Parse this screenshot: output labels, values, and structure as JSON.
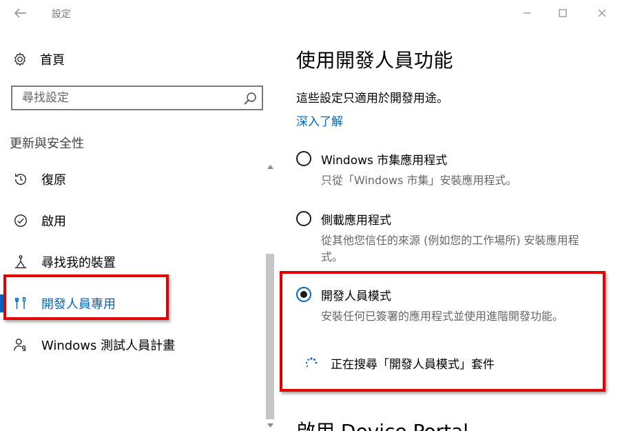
{
  "window": {
    "title": "設定",
    "back_icon": "arrow-left-icon",
    "controls": [
      "minimize-icon",
      "maximize-icon",
      "close-icon"
    ]
  },
  "sidebar": {
    "home_label": "首頁",
    "search_placeholder": "尋找設定",
    "section_title": "更新與安全性",
    "items": [
      {
        "label": "復原",
        "icon": "history-icon",
        "active": false
      },
      {
        "label": "啟用",
        "icon": "check-circle-icon",
        "active": false
      },
      {
        "label": "尋找我的裝置",
        "icon": "person-pin-icon",
        "active": false
      },
      {
        "label": "開發人員專用",
        "icon": "developer-tools-icon",
        "active": true
      },
      {
        "label": "Windows 測試人員計畫",
        "icon": "insider-person-icon",
        "active": false
      }
    ]
  },
  "main": {
    "title": "使用開發人員功能",
    "description": "這些設定只適用於開發用途。",
    "learn_more": "深入了解",
    "options": [
      {
        "label": "Windows 市集應用程式",
        "description": "只從「Windows 市集」安裝應用程式。",
        "selected": false
      },
      {
        "label": "側載應用程式",
        "description": "從其他您信任的來源 (例如您的工作場所) 安裝應用程式。",
        "selected": false
      },
      {
        "label": "開發人員模式",
        "description": "安裝任何已簽署的應用程式並使用進階開發功能。",
        "selected": true
      }
    ],
    "status": "正在搜尋「開發人員模式」套件",
    "next_section_title": "啟用 Device Portal"
  },
  "colors": {
    "accent": "#0067c0",
    "highlight": "#e20000"
  }
}
